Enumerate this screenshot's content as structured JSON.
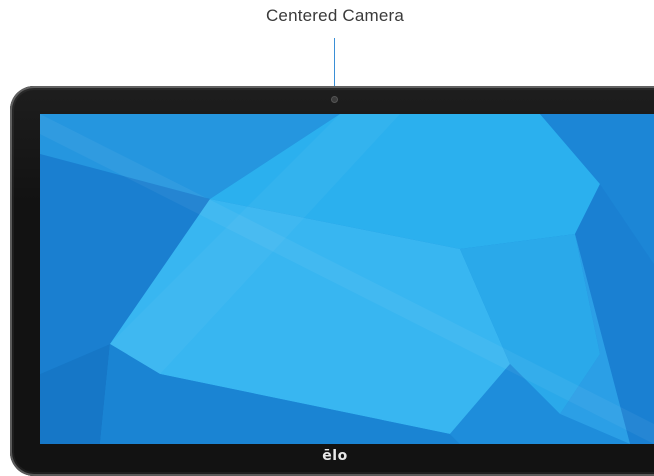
{
  "callout": {
    "label": "Centered Camera"
  },
  "device": {
    "logo": "ēlo"
  },
  "colors": {
    "screen_base": "#2aa2e8",
    "callout_accent": "#2f92e0",
    "bezel": "#121212"
  }
}
